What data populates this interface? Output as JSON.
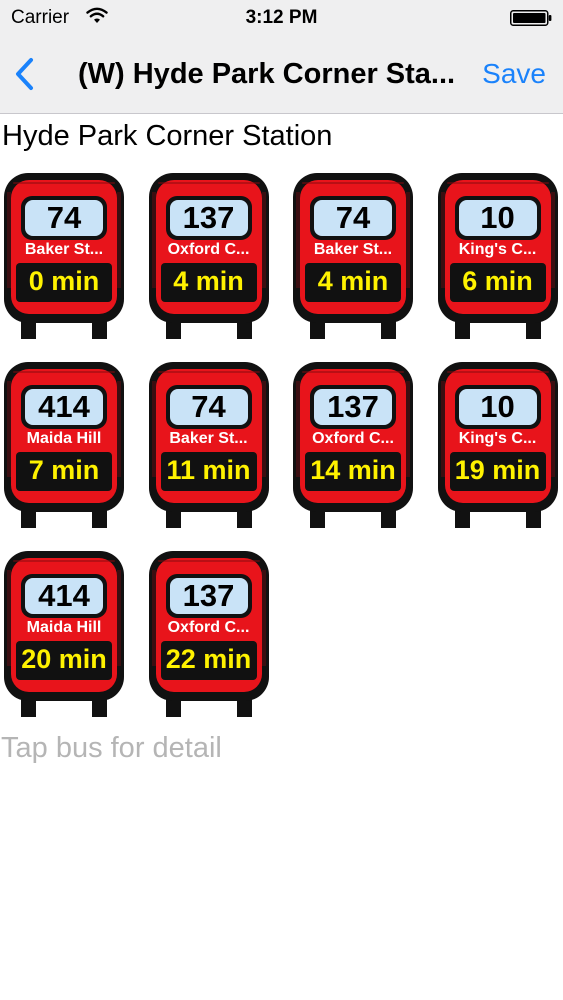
{
  "status_bar": {
    "carrier": "Carrier",
    "time": "3:12 PM"
  },
  "nav": {
    "title": "(W) Hyde Park Corner Sta...",
    "save_label": "Save",
    "back_icon": "chevron-left-icon"
  },
  "stop_name": "Hyde Park Corner Station",
  "buses": [
    {
      "route": "74",
      "destination": "Baker St...",
      "eta": "0 min"
    },
    {
      "route": "137",
      "destination": "Oxford C...",
      "eta": "4 min"
    },
    {
      "route": "74",
      "destination": "Baker St...",
      "eta": "4 min"
    },
    {
      "route": "10",
      "destination": "King's C...",
      "eta": "6 min"
    },
    {
      "route": "414",
      "destination": "Maida Hill",
      "eta": "7 min"
    },
    {
      "route": "74",
      "destination": "Baker St...",
      "eta": "11 min"
    },
    {
      "route": "137",
      "destination": "Oxford C...",
      "eta": "14 min"
    },
    {
      "route": "10",
      "destination": "King's C...",
      "eta": "19 min"
    },
    {
      "route": "414",
      "destination": "Maida Hill",
      "eta": "20 min"
    },
    {
      "route": "137",
      "destination": "Oxford C...",
      "eta": "22 min"
    }
  ],
  "hint": "Tap bus for detail",
  "colors": {
    "accent": "#1a82fb",
    "bus_red": "#e8141b",
    "bus_outline": "#111111",
    "window_blue": "#c9e3f7",
    "eta_yellow": "#fff200",
    "hint_gray": "#b5b5b5"
  }
}
